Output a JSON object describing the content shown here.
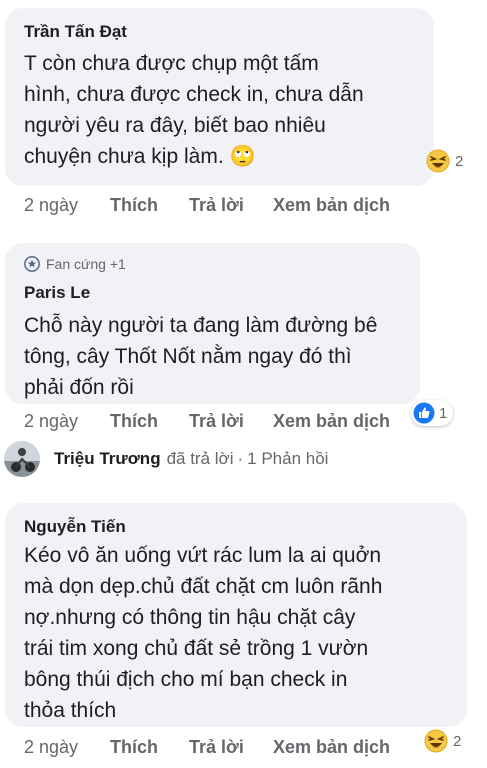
{
  "comments": [
    {
      "author": "Trần Tấn Đạt",
      "lines": [
        "T còn chưa được chụp một tấm",
        "hình, chưa được check in, chưa dẫn",
        "người yêu ra đây, biết bao nhiêu",
        "chuyện chưa kịp làm. 🙄"
      ],
      "reaction": {
        "icon": "laughing-emoji",
        "count": "2"
      },
      "time": "2 ngày",
      "like_label": "Thích",
      "reply_label": "Trả lời",
      "translate_label": "Xem bản dịch"
    },
    {
      "badge": "Fan cứng +1",
      "author": "Paris Le",
      "lines": [
        "Chỗ này người ta đang làm đường bê",
        "tông, cây Thốt Nốt nằm ngay đó thì",
        "phải đốn rồi"
      ],
      "reaction": {
        "icon": "like-thumb",
        "count": "1"
      },
      "time": "2 ngày",
      "like_label": "Thích",
      "reply_label": "Trả lời",
      "translate_label": "Xem bản dịch"
    },
    {
      "author": "Nguyễn Tiến",
      "lines": [
        "Kéo vô ăn uống vứt rác lum la ai quởn",
        "mà dọn dẹp.chủ đất chặt cm luôn rãnh",
        "nợ.nhưng có thông tin hậu chặt cây",
        "trái tim xong chủ đất sẻ trồng 1 vườn",
        "bông thúi địch cho mí bạn check in",
        "thỏa thích"
      ],
      "reaction": {
        "icon": "laughing-emoji",
        "count": "2"
      },
      "time": "2 ngày",
      "like_label": "Thích",
      "reply_label": "Trả lời",
      "translate_label": "Xem bản dịch"
    }
  ],
  "reply_summary": {
    "name": "Triệu Trương",
    "action": "đã trả lời",
    "separator": "·",
    "count_label": "1 Phản hồi"
  }
}
